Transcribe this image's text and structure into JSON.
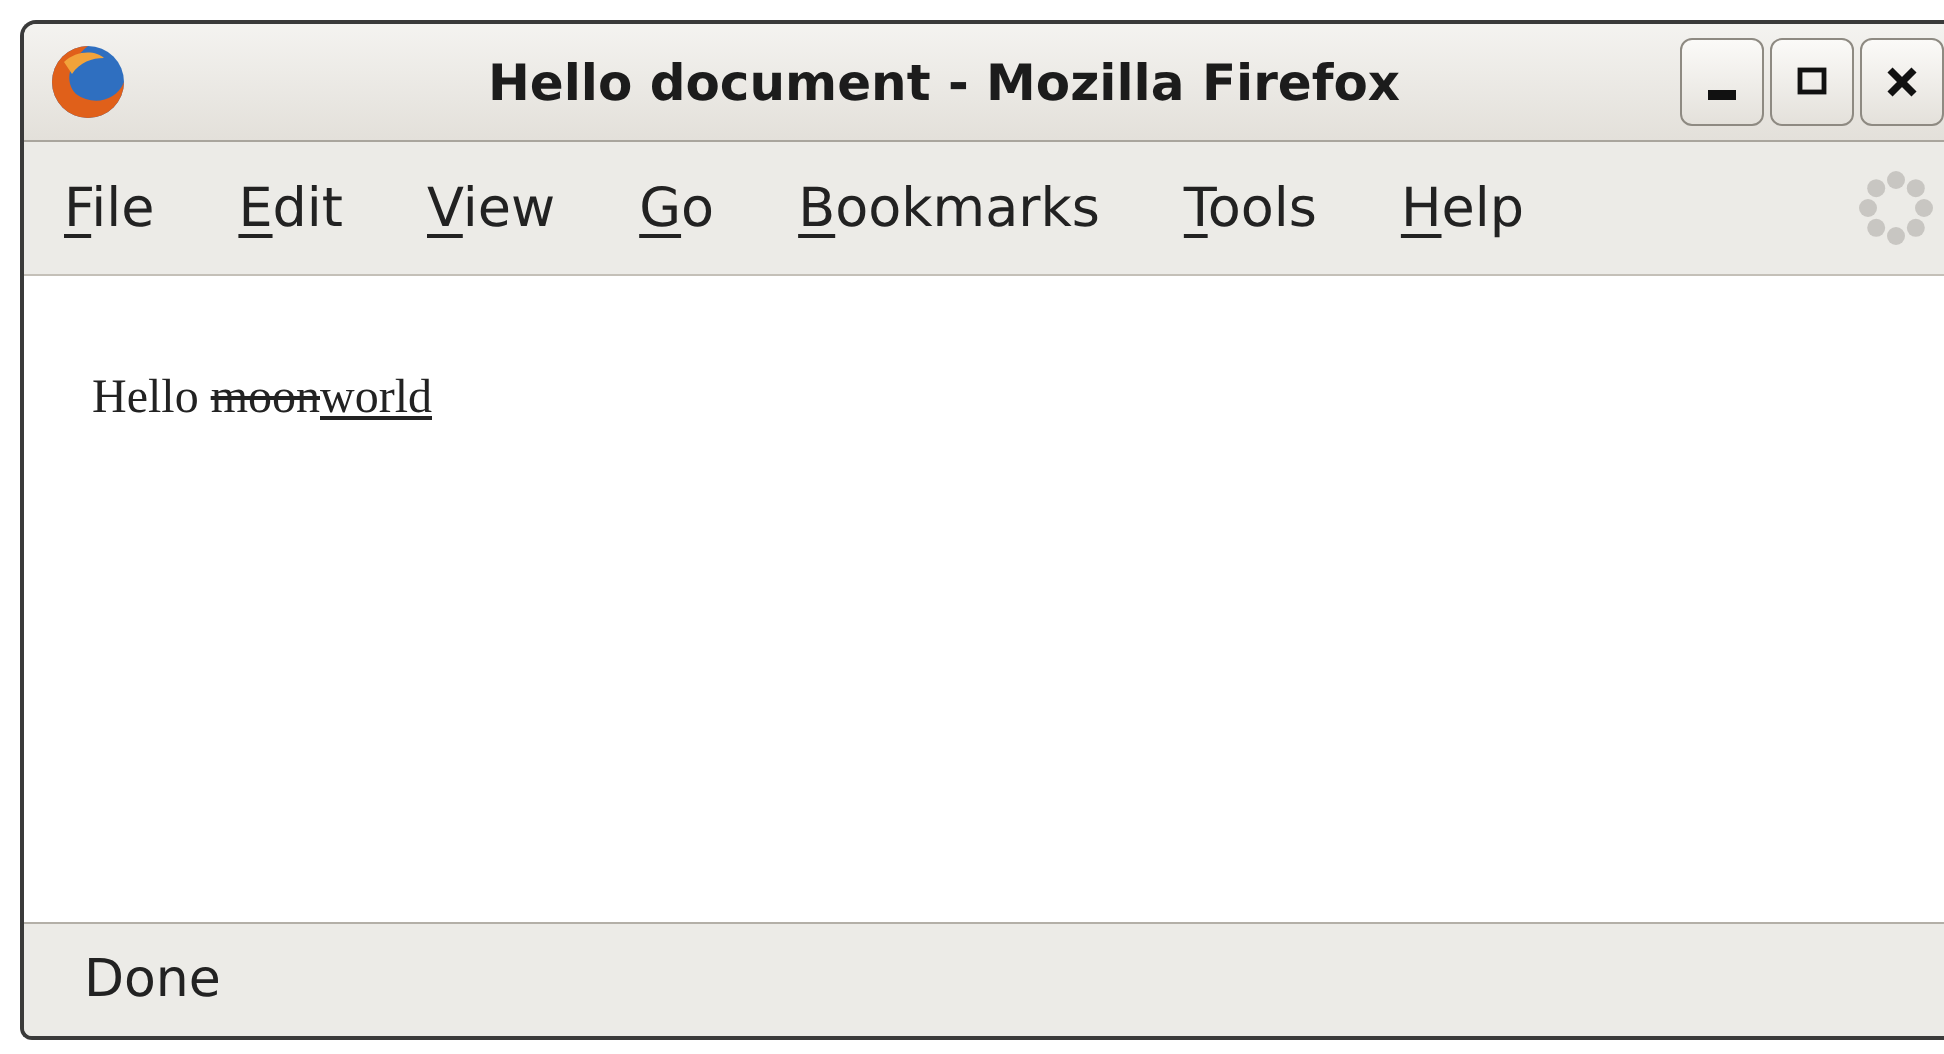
{
  "window": {
    "title": "Hello document - Mozilla Firefox",
    "controls": [
      {
        "kind": "minimize"
      },
      {
        "kind": "maximize"
      },
      {
        "kind": "close"
      }
    ]
  },
  "menu": [
    {
      "label": "File"
    },
    {
      "label": "Edit"
    },
    {
      "label": "View"
    },
    {
      "label": "Go"
    },
    {
      "label": "Bookmarks"
    },
    {
      "label": "Tools"
    },
    {
      "label": "Help"
    }
  ],
  "content": {
    "parts": [
      {
        "text": "Hello ",
        "kind": "plain"
      },
      {
        "text": "moon",
        "kind": "deleted"
      },
      {
        "text": "world",
        "kind": "inserted"
      }
    ]
  },
  "status_bar": {
    "text": "Done"
  }
}
